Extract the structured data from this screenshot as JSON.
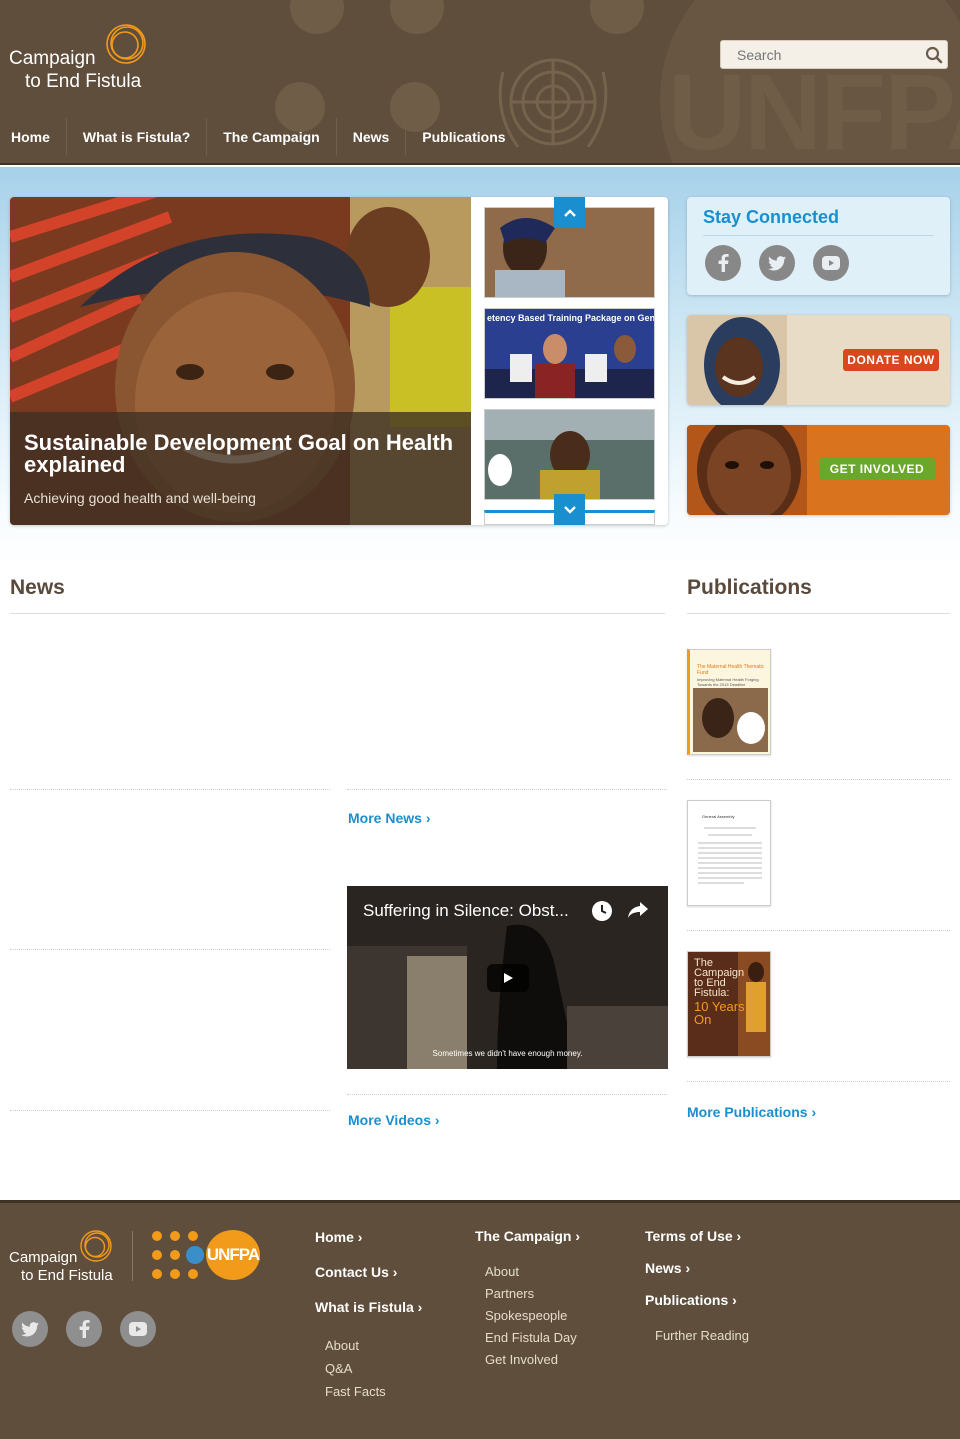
{
  "header": {
    "logo_line1": "Campaign",
    "logo_line2": "to End Fistula",
    "search_placeholder": "Search",
    "bg_brand": "UNFPA",
    "nav": [
      "Home",
      "What is Fistula?",
      "The Campaign",
      "News",
      "Publications"
    ]
  },
  "slider": {
    "title": "Sustainable Development Goal on Health explained",
    "subtitle": "Achieving good health and well-being",
    "thumb2_text": "etency Based Training Package on Gender Based Violence, Organ..."
  },
  "sidebar": {
    "stay_connected": "Stay Connected",
    "social": [
      "facebook-icon",
      "twitter-icon",
      "youtube-icon"
    ],
    "donate_label": "DONATE NOW",
    "involved_label": "GET INVOLVED"
  },
  "news": {
    "title": "News",
    "more_news": "More News",
    "more_videos": "More Videos",
    "video_title": "Suffering in Silence: Obst...",
    "video_subtitle": "Sometimes we didn't have enough money."
  },
  "publications": {
    "title": "Publications",
    "pub1_title": "The Maternal Health Thematic Fund",
    "pub1_sub": "Improving Maternal Health Forging Towards the 2015 Deadline",
    "pub2_header": "General Assembly",
    "pub3_title": "The Campaign to End Fistula:",
    "pub3_years": "10 Years On",
    "more": "More Publications"
  },
  "footer": {
    "logo_line1": "Campaign",
    "logo_line2": "to End Fistula",
    "unfpa": "UNFPA",
    "col1": {
      "home": "Home",
      "contact": "Contact Us",
      "fistula": "What is Fistula",
      "items": [
        "About",
        "Q&A",
        "Fast Facts"
      ]
    },
    "col2": {
      "title": "The Campaign",
      "items": [
        "About",
        "Partners",
        "Spokespeople",
        "End Fistula Day",
        "Get Involved"
      ]
    },
    "col3": {
      "terms": "Terms of Use",
      "news": "News",
      "publications": "Publications",
      "items": [
        "Further Reading"
      ]
    }
  },
  "colors": {
    "brown": "#5f4e3c",
    "accent_blue": "#1a8fcf",
    "orange": "#f29a1a",
    "donate_red": "#d9471c",
    "involved_green": "#6aa82c"
  }
}
